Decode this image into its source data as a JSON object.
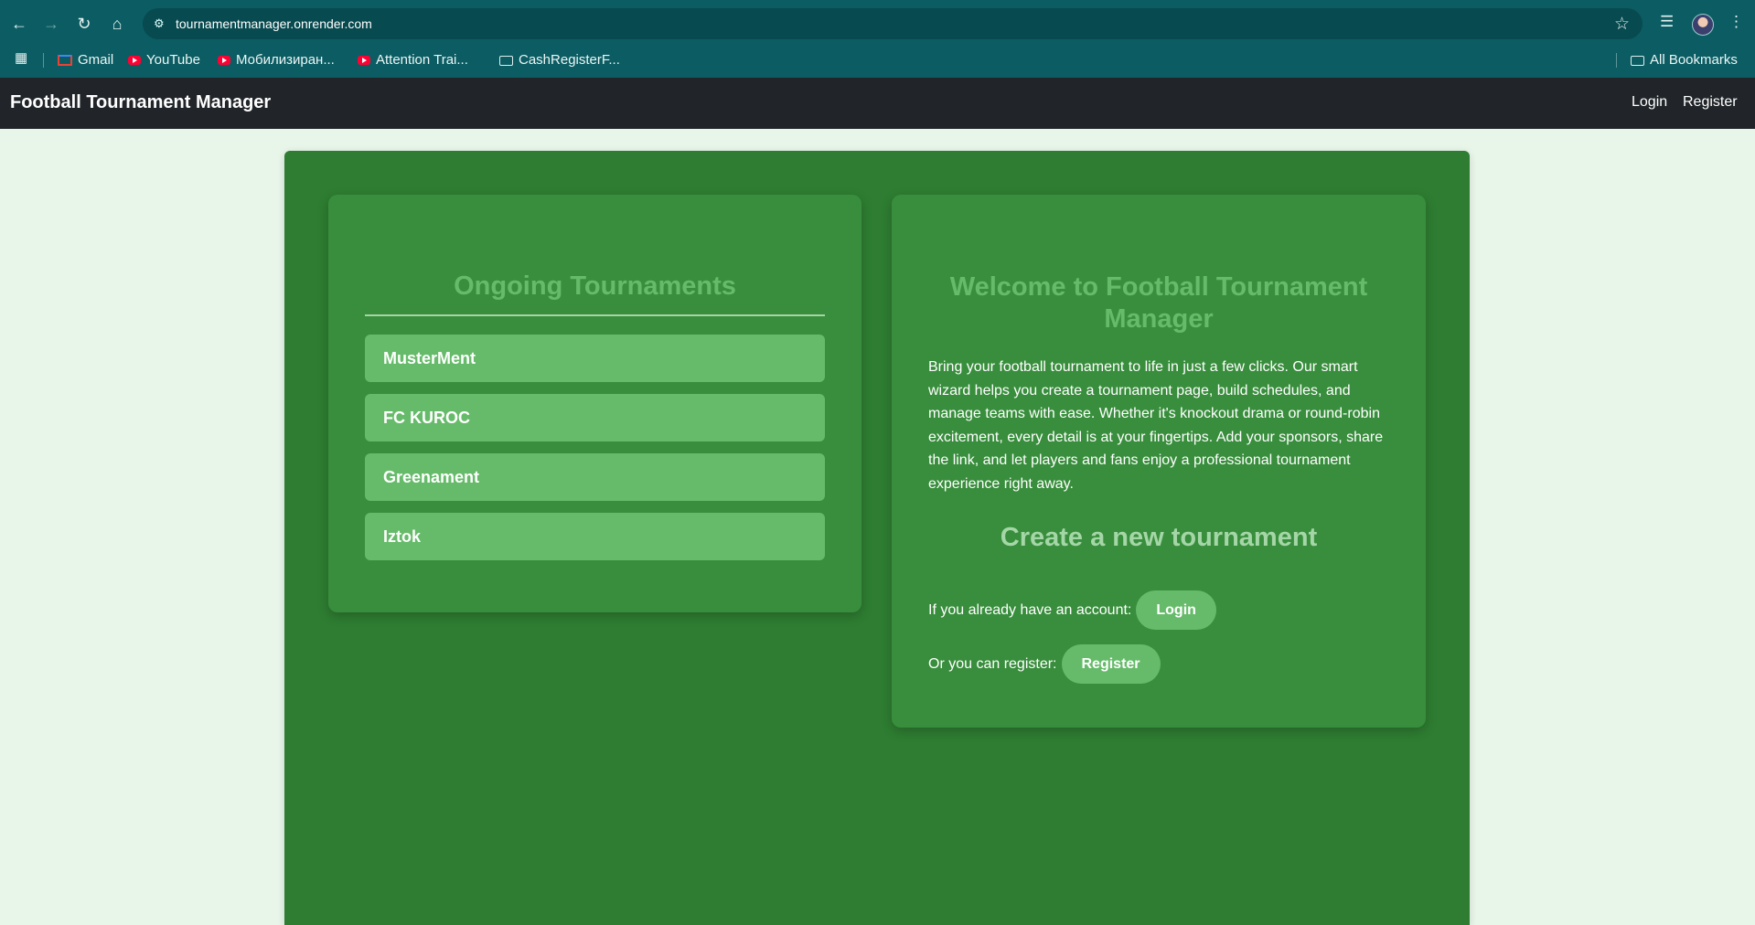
{
  "browser": {
    "url": "tournamentmanager.onrender.com",
    "bookmarks": [
      {
        "label": "Gmail",
        "icon": "gmail-icon"
      },
      {
        "label": "YouTube",
        "icon": "youtube-icon"
      },
      {
        "label": "Мобилизиран...",
        "icon": "youtube-icon"
      },
      {
        "label": "Attention Trai...",
        "icon": "youtube-icon"
      },
      {
        "label": "CashRegisterF...",
        "icon": "folder-icon"
      }
    ],
    "all_bookmarks": "All Bookmarks"
  },
  "navbar": {
    "brand": "Football Tournament Manager",
    "login": "Login",
    "register": "Register"
  },
  "ongoing": {
    "title": "Ongoing Tournaments",
    "items": [
      "MusterMent",
      "FC KUROC",
      "Greenament",
      "Iztok"
    ]
  },
  "welcome": {
    "title": "Welcome to Football Tournament Manager",
    "intro": "Bring your football tournament to life in just a few clicks. Our smart wizard helps you create a tournament page, build schedules, and manage teams with ease. Whether it's knockout drama or round-robin excitement, every detail is at your fingertips. Add your sponsors, share the link, and let players and fans enjoy a professional tournament experience right away.",
    "create_title": "Create a new tournament",
    "login_prompt": "If you already have an account:",
    "login_button": "Login",
    "register_prompt": "Or you can register:",
    "register_button": "Register"
  },
  "colors": {
    "page_bg": "#e8f5e9",
    "container": "#2e7d32",
    "card": "#388e3c",
    "accent": "#66bb6a",
    "navbar": "#212529",
    "browser_chrome": "#0b5d63"
  }
}
